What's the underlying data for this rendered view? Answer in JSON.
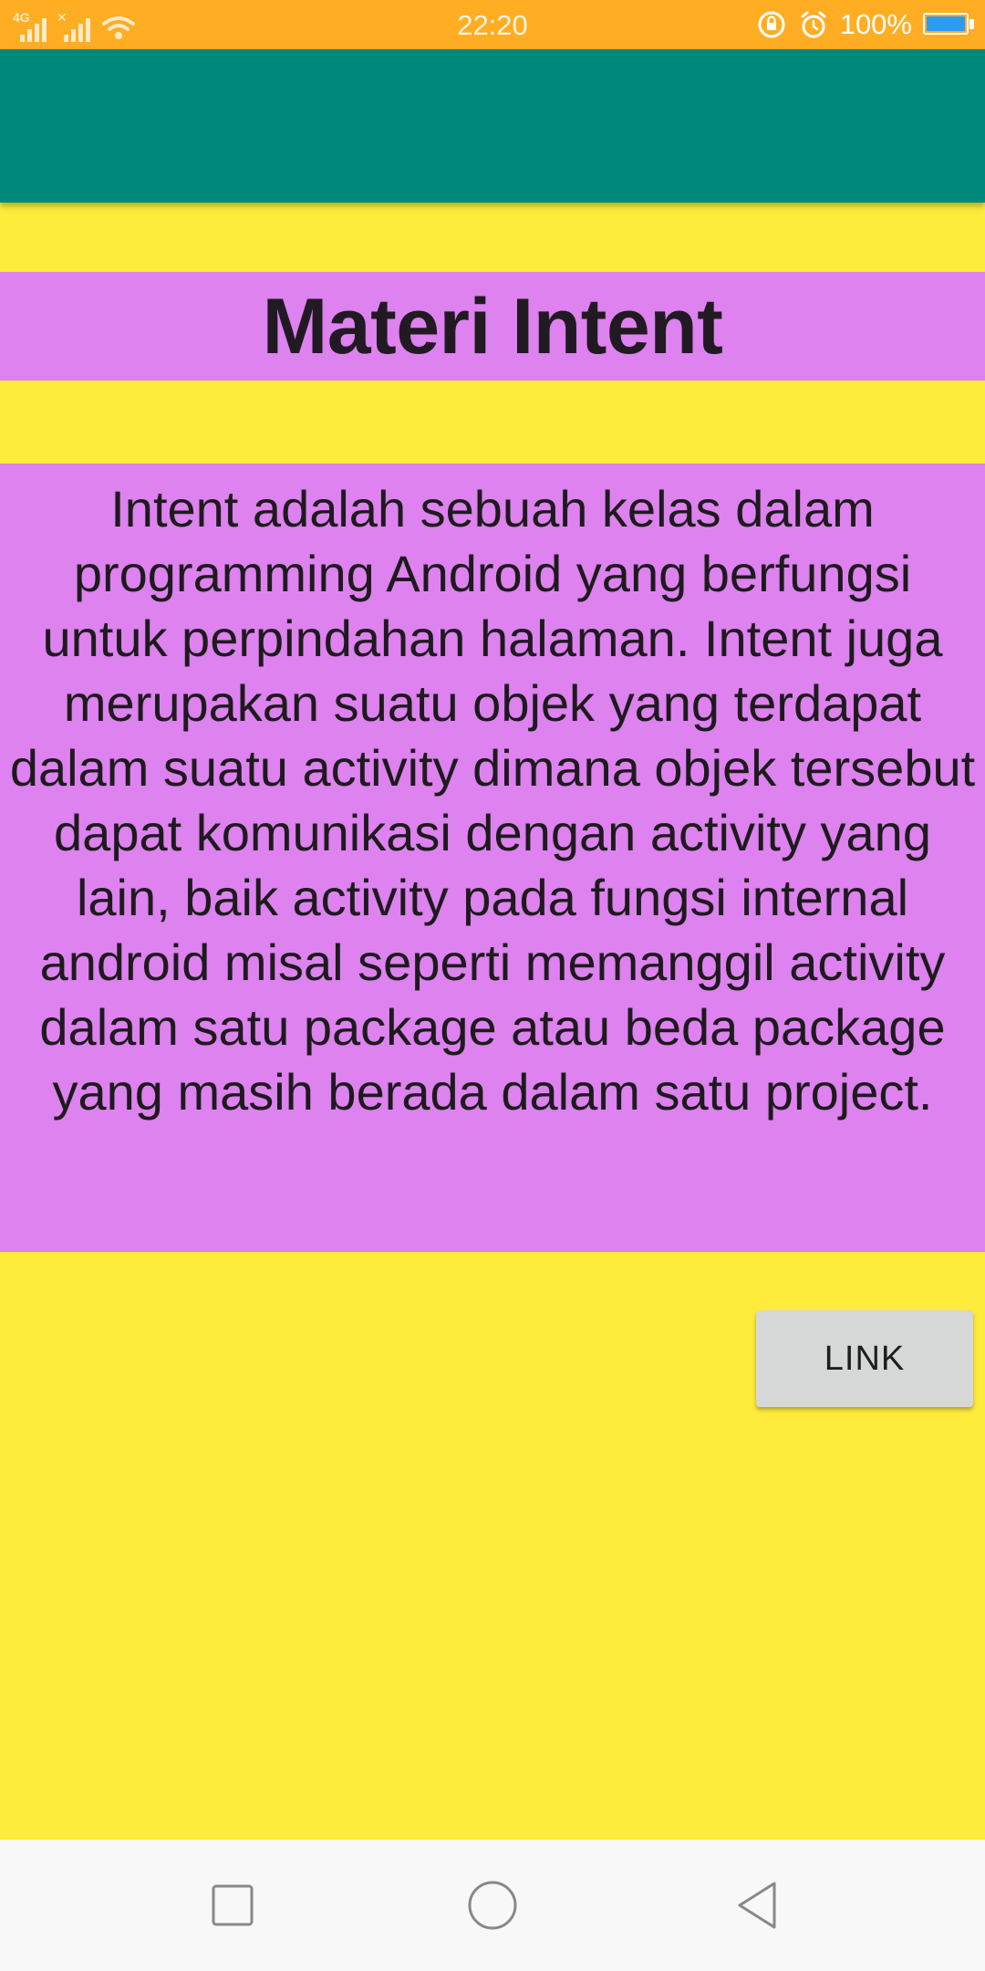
{
  "status_bar": {
    "time": "22:20",
    "battery_text": "100%",
    "network_label": "4G",
    "icons": [
      "signal-4g-icon",
      "signal-no-sim-icon",
      "wifi-icon",
      "rotation-lock-icon",
      "alarm-icon",
      "battery-icon"
    ],
    "battery_level": 1.0
  },
  "colors": {
    "status_bar": "#ffad23",
    "app_bar": "#00897b",
    "background": "#ffeb3b",
    "content_band": "#dd82ef",
    "button": "#d6d7d7",
    "battery_fill": "#2f9bf0"
  },
  "main": {
    "title": "Materi Intent",
    "description": "Intent adalah sebuah kelas dalam programming Android yang berfungsi untuk perpindahan halaman. Intent juga merupakan suatu objek yang terdapat dalam suatu activity dimana objek tersebut dapat komunikasi dengan activity yang lain, baik activity pada fungsi internal android misal seperti memanggil activity dalam satu package atau beda package yang masih berada dalam satu project.",
    "link_button_label": "LINK"
  },
  "nav_bar": {
    "icons": [
      "recents-square-icon",
      "home-circle-icon",
      "back-triangle-icon"
    ]
  }
}
